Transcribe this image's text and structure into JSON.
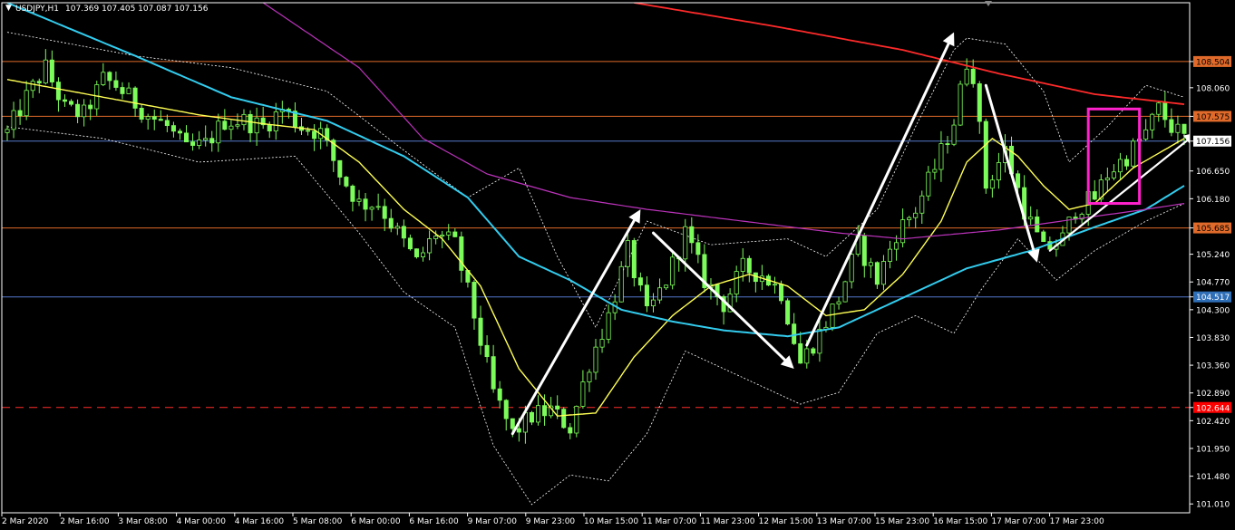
{
  "header": {
    "symbol_label": "USDJPY,H1",
    "ohlc_label": "107.369 107.405 107.087 107.156"
  },
  "colors": {
    "background": "#000000",
    "frame": "#ffffff",
    "candle": "#7cfc5a",
    "sma_short": "#ffff55",
    "sma_mid": "#33ccee",
    "sma_long": "#bb33bb",
    "sma_200": "#ff2a2a",
    "bands": "#ffffff",
    "resistance": "#e06a2a",
    "support_blue": "#5577cc",
    "dashed_red": "#ff2a2a",
    "box": "#ff22cc",
    "arrow": "#ffffff",
    "level_orange": "#e06a2a",
    "level_current": "#ffffff",
    "level_blue": "#2f6fb8",
    "level_red": "#ff0000"
  },
  "chart_data": {
    "type": "candlestick",
    "symbol": "USDJPY",
    "timeframe": "H1",
    "last_ohlc": {
      "open": 107.369,
      "high": 107.405,
      "low": 107.087,
      "close": 107.156
    },
    "ylim": [
      100.86,
      109.5
    ],
    "y_ticks": [
      "108.504",
      "108.060",
      "107.575",
      "107.156",
      "106.650",
      "106.180",
      "105.685",
      "105.240",
      "104.770",
      "104.517",
      "104.300",
      "103.830",
      "103.360",
      "102.890",
      "102.644",
      "102.420",
      "101.950",
      "101.480",
      "101.010"
    ],
    "x_ticks": [
      "2 Mar 2020",
      "2 Mar 16:00",
      "3 Mar 08:00",
      "4 Mar 00:00",
      "4 Mar 16:00",
      "5 Mar 08:00",
      "6 Mar 00:00",
      "6 Mar 16:00",
      "9 Mar 07:00",
      "9 Mar 23:00",
      "10 Mar 15:00",
      "11 Mar 07:00",
      "11 Mar 23:00",
      "12 Mar 15:00",
      "13 Mar 07:00",
      "15 Mar 23:00",
      "16 Mar 15:00",
      "17 Mar 07:00",
      "17 Mar 23:00"
    ],
    "price_levels": [
      {
        "label": "108.504",
        "value": 108.504,
        "role": "resistance",
        "style": "solid"
      },
      {
        "label": "107.575",
        "value": 107.575,
        "role": "resistance",
        "style": "solid"
      },
      {
        "label": "107.156",
        "value": 107.156,
        "role": "current",
        "style": "solid"
      },
      {
        "label": "105.685",
        "value": 105.685,
        "role": "support",
        "style": "solid"
      },
      {
        "label": "104.517",
        "value": 104.517,
        "role": "support",
        "style": "solid"
      },
      {
        "label": "102.644",
        "value": 102.644,
        "role": "support",
        "style": "dashed"
      }
    ],
    "close_path": [
      [
        0,
        107.3
      ],
      [
        3,
        107.9
      ],
      [
        6,
        108.4
      ],
      [
        9,
        107.7
      ],
      [
        12,
        107.6
      ],
      [
        15,
        108.2
      ],
      [
        17,
        108.1
      ],
      [
        19,
        107.9
      ],
      [
        22,
        107.6
      ],
      [
        25,
        107.4
      ],
      [
        28,
        107.0
      ],
      [
        31,
        107.1
      ],
      [
        34,
        107.5
      ],
      [
        37,
        107.5
      ],
      [
        40,
        107.4
      ],
      [
        43,
        107.7
      ],
      [
        46,
        107.4
      ],
      [
        49,
        107.3
      ],
      [
        52,
        106.6
      ],
      [
        55,
        106.1
      ],
      [
        58,
        106.1
      ],
      [
        61,
        105.6
      ],
      [
        64,
        105.1
      ],
      [
        67,
        105.6
      ],
      [
        70,
        105.4
      ],
      [
        73,
        104.2
      ],
      [
        76,
        102.9
      ],
      [
        79,
        102.2
      ],
      [
        82,
        102.5
      ],
      [
        85,
        102.6
      ],
      [
        88,
        102.3
      ],
      [
        91,
        103.4
      ],
      [
        94,
        104.2
      ],
      [
        97,
        105.3
      ],
      [
        100,
        104.2
      ],
      [
        103,
        104.8
      ],
      [
        106,
        105.6
      ],
      [
        109,
        104.8
      ],
      [
        112,
        104.4
      ],
      [
        115,
        105.0
      ],
      [
        118,
        104.9
      ],
      [
        121,
        104.6
      ],
      [
        124,
        103.4
      ],
      [
        127,
        103.9
      ],
      [
        130,
        104.5
      ],
      [
        133,
        105.4
      ],
      [
        136,
        104.8
      ],
      [
        139,
        105.6
      ],
      [
        142,
        106.0
      ],
      [
        145,
        106.7
      ],
      [
        148,
        107.5
      ],
      [
        150,
        108.5
      ],
      [
        151,
        108.3
      ],
      [
        153,
        106.4
      ],
      [
        156,
        107.0
      ],
      [
        159,
        106.0
      ],
      [
        162,
        105.3
      ],
      [
        165,
        105.5
      ],
      [
        167,
        106.0
      ],
      [
        170,
        106.2
      ],
      [
        172,
        106.6
      ],
      [
        175,
        106.9
      ],
      [
        178,
        107.3
      ],
      [
        180,
        107.7
      ],
      [
        182,
        107.4
      ],
      [
        184,
        107.2
      ]
    ],
    "series": [
      {
        "values": [
          [
            0,
            108.2
          ],
          [
            15,
            107.9
          ],
          [
            30,
            107.6
          ],
          [
            40,
            107.45
          ],
          [
            48,
            107.35
          ],
          [
            55,
            106.8
          ],
          [
            62,
            106.0
          ],
          [
            68,
            105.5
          ],
          [
            74,
            104.7
          ],
          [
            80,
            103.3
          ],
          [
            86,
            102.5
          ],
          [
            92,
            102.55
          ],
          [
            98,
            103.5
          ],
          [
            104,
            104.2
          ],
          [
            110,
            104.7
          ],
          [
            116,
            104.9
          ],
          [
            122,
            104.7
          ],
          [
            128,
            104.2
          ],
          [
            134,
            104.3
          ],
          [
            140,
            104.9
          ],
          [
            146,
            105.8
          ],
          [
            150,
            106.8
          ],
          [
            154,
            107.2
          ],
          [
            158,
            106.9
          ],
          [
            162,
            106.4
          ],
          [
            166,
            106.0
          ],
          [
            170,
            106.1
          ],
          [
            176,
            106.7
          ],
          [
            184,
            107.2
          ]
        ]
      },
      {
        "values": [
          [
            0,
            109.5
          ],
          [
            20,
            108.6
          ],
          [
            35,
            107.9
          ],
          [
            50,
            107.5
          ],
          [
            62,
            106.9
          ],
          [
            72,
            106.2
          ],
          [
            80,
            105.2
          ],
          [
            88,
            104.8
          ],
          [
            96,
            104.3
          ],
          [
            104,
            104.1
          ],
          [
            112,
            103.95
          ],
          [
            122,
            103.85
          ],
          [
            130,
            104.0
          ],
          [
            140,
            104.5
          ],
          [
            150,
            105.0
          ],
          [
            160,
            105.3
          ],
          [
            170,
            105.7
          ],
          [
            178,
            106.0
          ],
          [
            184,
            106.4
          ]
        ]
      },
      {
        "values": [
          [
            40,
            109.5
          ],
          [
            55,
            108.4
          ],
          [
            65,
            107.2
          ],
          [
            75,
            106.6
          ],
          [
            88,
            106.2
          ],
          [
            100,
            106.0
          ],
          [
            115,
            105.8
          ],
          [
            130,
            105.6
          ],
          [
            140,
            105.5
          ],
          [
            155,
            105.65
          ],
          [
            168,
            105.85
          ],
          [
            178,
            106.0
          ],
          [
            184,
            106.1
          ]
        ]
      },
      {
        "values": [
          [
            98,
            109.5
          ],
          [
            120,
            109.1
          ],
          [
            140,
            108.7
          ],
          [
            155,
            108.3
          ],
          [
            170,
            107.95
          ],
          [
            184,
            107.78
          ]
        ]
      }
    ],
    "bollinger_upper": [
      [
        0,
        109.0
      ],
      [
        20,
        108.6
      ],
      [
        35,
        108.4
      ],
      [
        50,
        108.0
      ],
      [
        62,
        107.0
      ],
      [
        72,
        106.2
      ],
      [
        80,
        106.7
      ],
      [
        86,
        105.2
      ],
      [
        92,
        104.0
      ],
      [
        100,
        105.8
      ],
      [
        110,
        105.4
      ],
      [
        122,
        105.5
      ],
      [
        128,
        105.2
      ],
      [
        136,
        106.0
      ],
      [
        142,
        107.4
      ],
      [
        148,
        108.7
      ],
      [
        150,
        108.9
      ],
      [
        156,
        108.8
      ],
      [
        162,
        108.0
      ],
      [
        166,
        106.8
      ],
      [
        172,
        107.4
      ],
      [
        178,
        108.1
      ],
      [
        184,
        107.9
      ]
    ],
    "bollinger_lower": [
      [
        0,
        107.4
      ],
      [
        15,
        107.2
      ],
      [
        30,
        106.8
      ],
      [
        45,
        106.9
      ],
      [
        55,
        105.6
      ],
      [
        62,
        104.6
      ],
      [
        70,
        104.0
      ],
      [
        76,
        102.0
      ],
      [
        82,
        101.0
      ],
      [
        88,
        101.5
      ],
      [
        94,
        101.4
      ],
      [
        100,
        102.2
      ],
      [
        106,
        103.6
      ],
      [
        112,
        103.3
      ],
      [
        118,
        103.0
      ],
      [
        124,
        102.7
      ],
      [
        130,
        102.9
      ],
      [
        136,
        103.9
      ],
      [
        142,
        104.2
      ],
      [
        148,
        103.9
      ],
      [
        152,
        104.6
      ],
      [
        158,
        105.5
      ],
      [
        164,
        104.8
      ],
      [
        170,
        105.3
      ],
      [
        178,
        105.8
      ],
      [
        184,
        106.1
      ]
    ],
    "annotations": {
      "arrows": [
        {
          "from": [
            79,
            102.2
          ],
          "to": [
            99,
            106.0
          ]
        },
        {
          "from": [
            101,
            105.6
          ],
          "to": [
            123,
            103.3
          ]
        },
        {
          "from": [
            125,
            103.7
          ],
          "to": [
            148,
            109.0
          ]
        },
        {
          "from": [
            153,
            108.1
          ],
          "to": [
            161,
            105.1
          ]
        },
        {
          "from": [
            163,
            105.3
          ],
          "to": [
            186,
            107.3
          ]
        }
      ],
      "box": {
        "x0": 169,
        "x1": 177,
        "y0": 106.1,
        "y1": 107.7
      }
    }
  }
}
